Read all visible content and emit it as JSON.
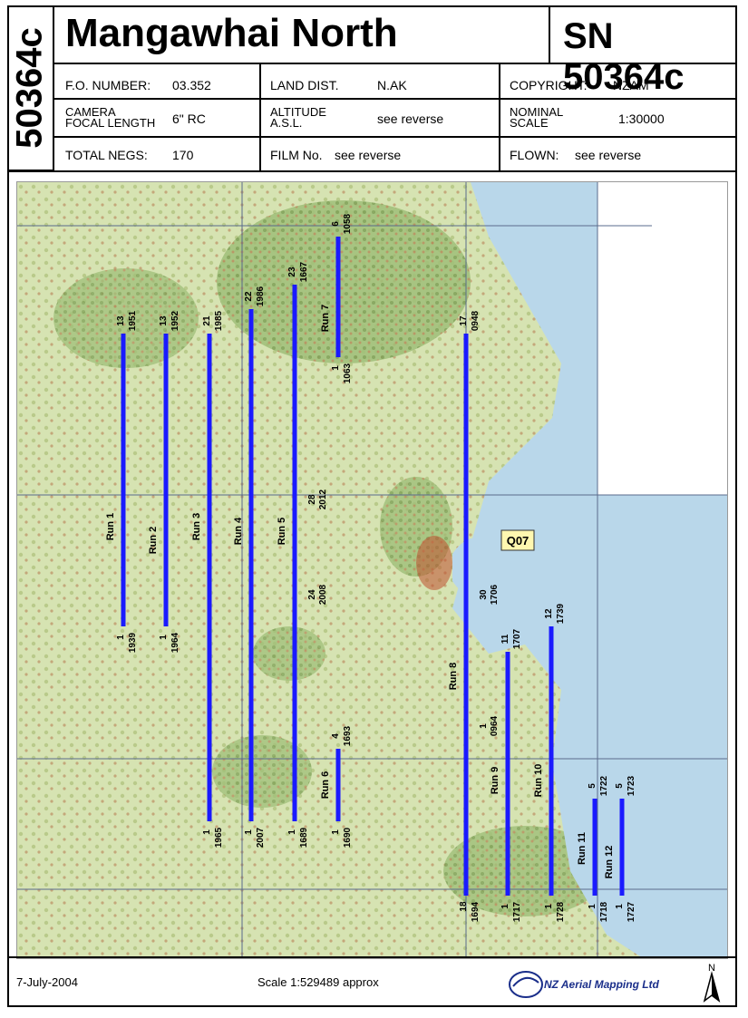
{
  "header": {
    "side_code": "50364c",
    "title": "Mangawhai North",
    "sn": "SN 50364c"
  },
  "info": {
    "fo_label": "F.O. NUMBER:",
    "fo_value": "03.352",
    "land_label": "LAND DIST.",
    "land_value": "N.AK",
    "copyright_label": "COPYRIGHT:",
    "copyright_value": "NZAM",
    "camera_label_1": "CAMERA",
    "camera_label_2": "FOCAL LENGTH",
    "camera_value": "6\" RC",
    "altitude_label_1": "ALTITUDE",
    "altitude_label_2": "A.S.L.",
    "altitude_value": "see reverse",
    "scale_label_1": "NOMINAL",
    "scale_label_2": "SCALE",
    "scale_value": "1:30000",
    "negs_label": "TOTAL NEGS:",
    "negs_value": "170",
    "film_label": "FILM No.",
    "film_value": "see reverse",
    "flown_label": "FLOWN:",
    "flown_value": "see reverse"
  },
  "map": {
    "sheet_label": "Q07",
    "colors": {
      "flight_line": "#1a1aff",
      "sea": "#b9d7ea",
      "land": "#cfe0a8",
      "grid": "#5a6b8c"
    },
    "runs": [
      {
        "name": "Run 1",
        "top_frame": "13",
        "top_neg": "1951",
        "bottom_frame": "1",
        "bottom_neg": "1939"
      },
      {
        "name": "Run 2",
        "top_frame": "13",
        "top_neg": "1952",
        "bottom_frame": "1",
        "bottom_neg": "1964"
      },
      {
        "name": "Run 3",
        "top_frame": "21",
        "top_neg": "1985",
        "bottom_frame": "1",
        "bottom_neg": "1965"
      },
      {
        "name": "Run 4",
        "top_frame": "22",
        "top_neg": "1986",
        "bottom_frame": "1",
        "bottom_neg": "2007"
      },
      {
        "name": "Run 5",
        "top_frame": "23",
        "top_neg": "1667",
        "bottom_frame": "1",
        "bottom_neg": "1689",
        "mid1_frame": "28",
        "mid1_neg": "2012",
        "mid2_frame": "24",
        "mid2_neg": "2008"
      },
      {
        "name": "Run 6",
        "top_frame": "4",
        "top_neg": "1693",
        "bottom_frame": "1",
        "bottom_neg": "1690"
      },
      {
        "name": "Run 7",
        "top_frame": "6",
        "top_neg": "1058",
        "bottom_frame": "1",
        "bottom_neg": "1063"
      },
      {
        "name": "Run 8",
        "top_frame": "17",
        "top_neg": "0948",
        "bottom_frame": "18",
        "bottom_neg": "1694",
        "mid1_frame": "30",
        "mid1_neg": "1706",
        "mid2_frame": "1",
        "mid2_neg": "0964"
      },
      {
        "name": "Run 9",
        "top_frame": "11",
        "top_neg": "1707",
        "bottom_frame": "1",
        "bottom_neg": "1717"
      },
      {
        "name": "Run 10",
        "top_frame": "12",
        "top_neg": "1739",
        "bottom_frame": "1",
        "bottom_neg": "1728"
      },
      {
        "name": "Run 11",
        "top_frame": "5",
        "top_neg": "1722",
        "bottom_frame": "1",
        "bottom_neg": "1718"
      },
      {
        "name": "Run 12",
        "top_frame": "5",
        "top_neg": "1723",
        "bottom_frame": "1",
        "bottom_neg": "1727"
      }
    ]
  },
  "footer": {
    "date": "7-July-2004",
    "scale": "Scale  1:529489 approx",
    "company": "NZ Aerial Mapping Ltd",
    "north_label": "N"
  }
}
